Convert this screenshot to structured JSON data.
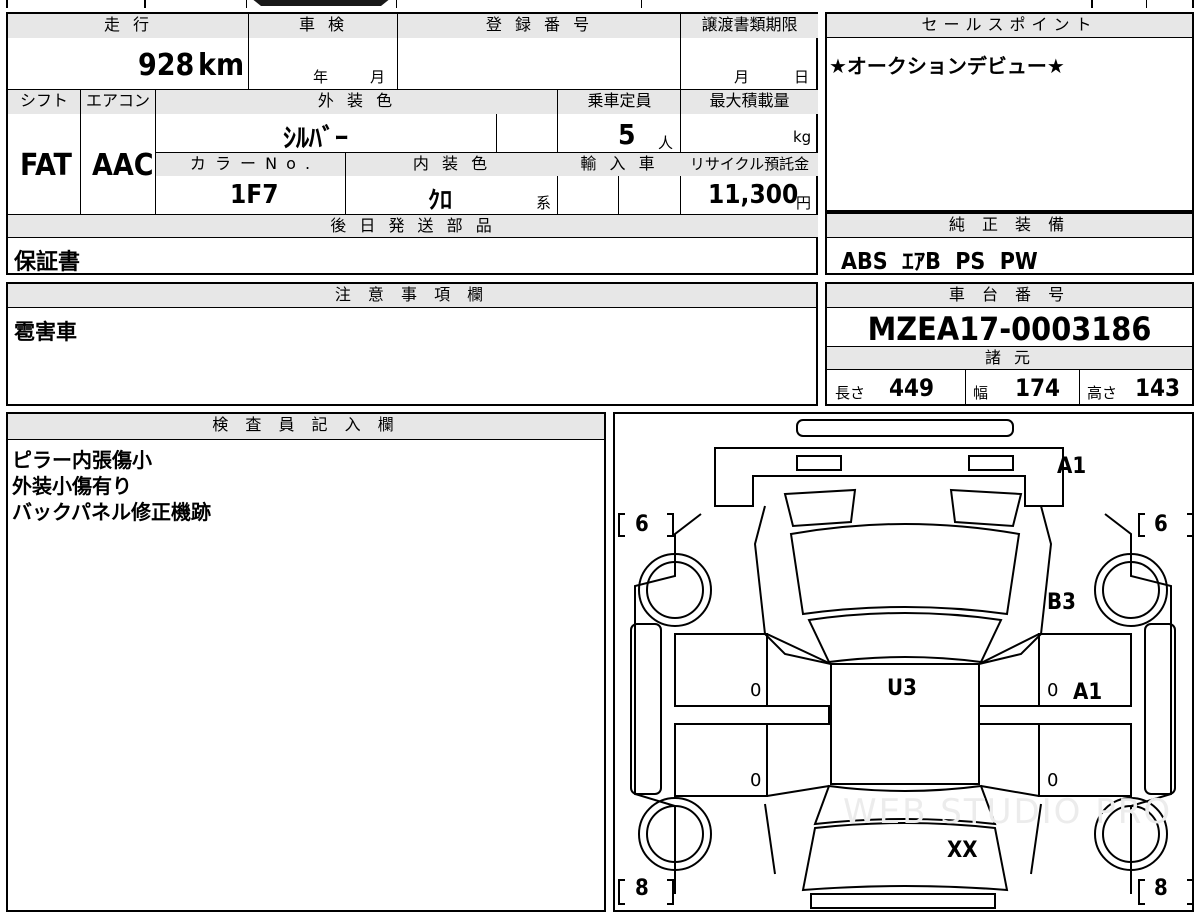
{
  "top": {
    "mileage_label": "走 行",
    "mileage_value": "928",
    "mileage_unit": "km",
    "inspection_label": "車 検",
    "inspection_year": "年",
    "inspection_month": "月",
    "registration_label": "登 録 番 号",
    "registration_value": "",
    "transfer_label": "譲渡書類期限",
    "transfer_month": "月",
    "transfer_day": "日"
  },
  "row2": {
    "shift_label": "シフト",
    "shift_value": "FAT",
    "ac_label": "エアコン",
    "ac_value": "AAC",
    "exterior_label": "外 装 色",
    "exterior_value": "ｼﾙﾊﾞｰ",
    "capacity_label": "乗車定員",
    "capacity_value": "5",
    "capacity_unit": "人",
    "load_label": "最大積載量",
    "load_unit": "kg",
    "color_no_label": "カ ラ ー  N o .",
    "color_no_value": "1F7",
    "interior_label": "内 装 色",
    "interior_value": "ｸﾛ",
    "interior_suffix": "系",
    "import_label": "輸 入 車",
    "recycle_label": "リサイクル預託金",
    "recycle_value": "11,300",
    "recycle_unit": "円"
  },
  "parts": {
    "label": "後 日 発 送 部 品",
    "value": "保証書"
  },
  "sales": {
    "label": "セールスポイント",
    "value": "★オークションデビュー★"
  },
  "equipment": {
    "label": "純 正 装 備",
    "value": "ABS  ｴｱB  PS  PW"
  },
  "notes": {
    "label": "注 意 事 項 欄",
    "value": "雹害車"
  },
  "chassis": {
    "label": "車 台 番 号",
    "value": "MZEA17-0003186",
    "spec_label": "諸 元",
    "length_label": "長さ",
    "length_value": "449",
    "width_label": "幅",
    "width_value": "174",
    "height_label": "高さ",
    "height_value": "143"
  },
  "inspector": {
    "label": "検 査 員 記 入 欄",
    "lines": [
      "ピラー内張傷小",
      "外装小傷有り",
      "バックパネル修正機跡"
    ]
  },
  "diagram": {
    "marks": {
      "a1_top": "A1",
      "b3": "B3",
      "u3": "U3",
      "a1_side": "A1",
      "xx": "XX",
      "zero_1": "0",
      "zero_2": "0",
      "zero_3": "0",
      "zero_4": "0"
    },
    "tires": {
      "front_left": "6",
      "front_right": "6",
      "rear_left": "8",
      "rear_right": "8"
    },
    "watermark": "WEB STUDIO PRO"
  }
}
